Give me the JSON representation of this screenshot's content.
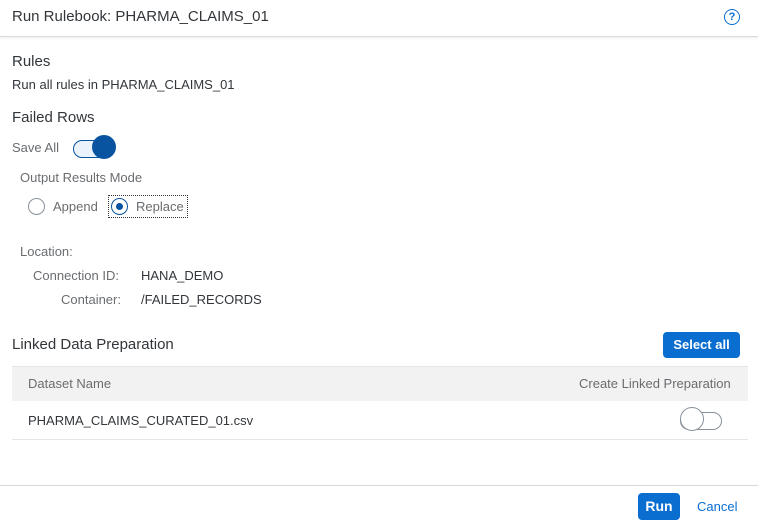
{
  "dialog": {
    "title": "Run Rulebook: PHARMA_CLAIMS_01",
    "help_icon_glyph": "?"
  },
  "rules": {
    "heading": "Rules",
    "description": "Run all rules in PHARMA_CLAIMS_01"
  },
  "failed_rows": {
    "heading": "Failed Rows",
    "save_all_label": "Save All",
    "save_all_on": true,
    "output_mode_label": "Output Results Mode",
    "options": [
      {
        "label": "Append",
        "selected": false
      },
      {
        "label": "Replace",
        "selected": true
      }
    ]
  },
  "location": {
    "heading": "Location:",
    "connection_label": "Connection ID:",
    "connection_value": "HANA_DEMO",
    "container_label": "Container:",
    "container_value": "/FAILED_RECORDS"
  },
  "linked": {
    "heading": "Linked Data Preparation",
    "select_all_label": "Select all",
    "columns": [
      "Dataset Name",
      "Create Linked Preparation"
    ],
    "rows": [
      {
        "dataset": "PHARMA_CLAIMS_CURATED_01.csv",
        "create": false
      }
    ]
  },
  "footer": {
    "run_label": "Run",
    "cancel_label": "Cancel"
  },
  "colors": {
    "accent": "#0a6ed1",
    "toggle_on": "#0854a0",
    "text": "#32363a"
  }
}
